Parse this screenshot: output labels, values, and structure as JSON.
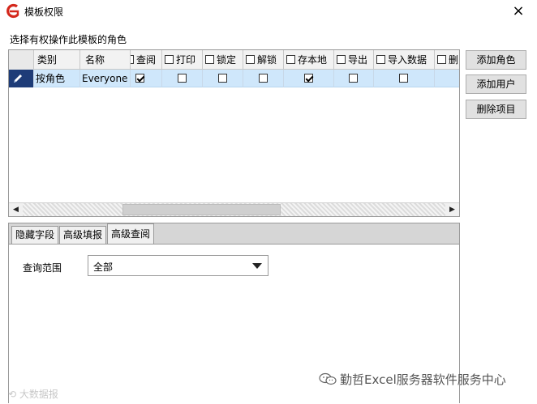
{
  "window": {
    "title": "模板权限",
    "close_glyph": "×",
    "icon": "app-logo-icon"
  },
  "section_label": "选择有权操作此模板的角色",
  "grid": {
    "columns": [
      {
        "label": "类别",
        "checkbox": false
      },
      {
        "label": "名称",
        "checkbox": false
      },
      {
        "label": "查阅",
        "checkbox": true
      },
      {
        "label": "打印",
        "checkbox": true
      },
      {
        "label": "锁定",
        "checkbox": true
      },
      {
        "label": "解锁",
        "checkbox": true
      },
      {
        "label": "存本地",
        "checkbox": true
      },
      {
        "label": "导出",
        "checkbox": true
      },
      {
        "label": "导入数据",
        "checkbox": true
      },
      {
        "label": "删",
        "checkbox": true
      }
    ],
    "rows": [
      {
        "category": "按角色",
        "name": "Everyone",
        "perms": [
          true,
          false,
          false,
          false,
          true,
          false,
          false
        ]
      }
    ],
    "scroll_left_glyph": "◀",
    "scroll_right_glyph": "▶"
  },
  "buttons": {
    "add_role": "添加角色",
    "add_user": "添加用户",
    "delete_item": "删除项目"
  },
  "tabs": [
    {
      "label": "隐藏字段",
      "active": false
    },
    {
      "label": "高级填报",
      "active": false
    },
    {
      "label": "高级查阅",
      "active": true
    }
  ],
  "query": {
    "label": "查询范围",
    "value": "全部"
  },
  "watermarks": {
    "right": "勤哲Excel服务器软件服务中心",
    "left": "大数据报"
  },
  "colors": {
    "selected_row": "#cfe7fb",
    "row_indicator": "#1e3c78",
    "logo_red": "#d4281c"
  }
}
